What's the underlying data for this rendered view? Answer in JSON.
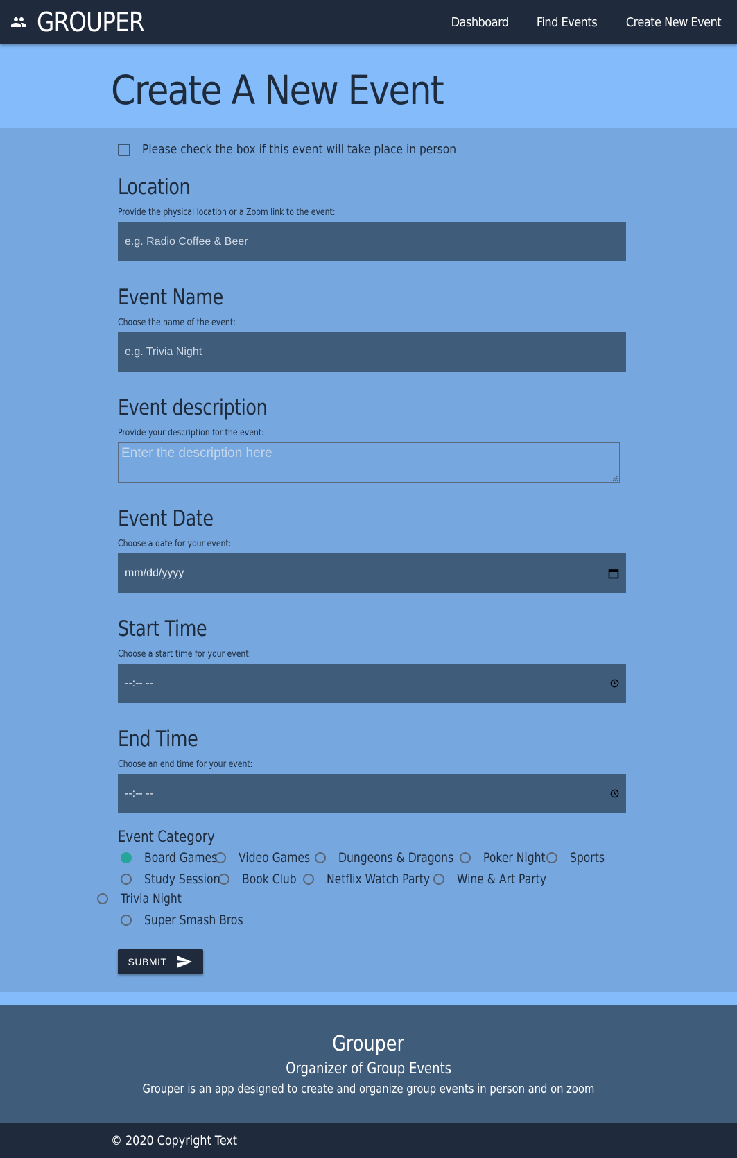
{
  "nav": {
    "brand": "GROUPER",
    "brand_icon": "group-icon",
    "links": [
      "Dashboard",
      "Find Events",
      "Create New Event"
    ]
  },
  "hero": {
    "title": "Create A New Event"
  },
  "form": {
    "in_person_label": "Please check the box if this event will take place in person",
    "in_person_checked": false,
    "location": {
      "title": "Location",
      "help": "Provide the physical location or a Zoom link to the event:",
      "placeholder": "e.g. Radio Coffee & Beer"
    },
    "event_name": {
      "title": "Event Name",
      "help": "Choose the name of the event:",
      "placeholder": "e.g. Trivia Night"
    },
    "description": {
      "title": "Event description",
      "help": "Provide your description for the event:",
      "placeholder": "Enter the description here"
    },
    "date": {
      "title": "Event Date",
      "help": "Choose a date for your event:",
      "value": "mm/dd/yyyy",
      "icon": "calendar-icon"
    },
    "start_time": {
      "title": "Start Time",
      "help": "Choose a start time for your event:",
      "value": "--:-- --",
      "icon": "clock-icon"
    },
    "end_time": {
      "title": "End Time",
      "help": "Choose an end time for your event:",
      "value": "--:-- --",
      "icon": "clock-icon"
    },
    "category": {
      "title": "Event Category",
      "options": [
        "Board Games",
        "Video Games",
        "Dungeons & Dragons",
        "Poker Night",
        "Sports",
        "Study Session",
        "Book Club",
        "Netflix Watch Party",
        "Wine & Art Party",
        "Trivia Night",
        "Super Smash Bros"
      ],
      "selected": "Board Games"
    },
    "submit_label": "SUBMIT",
    "submit_icon": "send-icon"
  },
  "footer": {
    "title": "Grouper",
    "subtitle": "Organizer of Group Events",
    "description": "Grouper is an app designed to create and organize group events in person and on zoom",
    "copyright": "© 2020 Copyright Text"
  },
  "colors": {
    "nav_bg": "#1f2b3d",
    "hero_bg": "#84bbfb",
    "page_bg": "#76a7de",
    "input_bg": "#405c7b",
    "radio_checked": "#26a69a",
    "footer_bg": "#405c7b"
  }
}
